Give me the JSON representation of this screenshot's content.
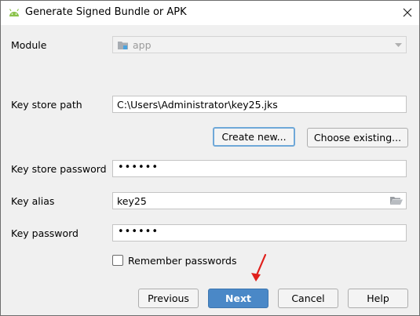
{
  "window": {
    "title": "Generate Signed Bundle or APK",
    "icons": {
      "app": "android-icon",
      "close": "close-icon"
    }
  },
  "module": {
    "label": "Module",
    "selected": "app",
    "icon": "folder-module-icon"
  },
  "keystore": {
    "path_label": "Key store path",
    "path_value": "C:\\Users\\Administrator\\key25.jks",
    "create_new_label": "Create new...",
    "choose_existing_label": "Choose existing...",
    "password_label": "Key store password",
    "password_mask": "••••••"
  },
  "key": {
    "alias_label": "Key alias",
    "alias_value": "key25",
    "alias_browse_icon": "folder-open-icon",
    "password_label": "Key password",
    "password_mask": "••••••"
  },
  "remember": {
    "label": "Remember passwords",
    "checked": false
  },
  "footer": {
    "previous_label": "Previous",
    "next_label": "Next",
    "cancel_label": "Cancel",
    "help_label": "Help"
  },
  "colors": {
    "primary_button": "#4a88c7",
    "focus_ring": "#6fa8d8",
    "annotation_arrow": "#e0201c",
    "android_green": "#8bc34a"
  }
}
